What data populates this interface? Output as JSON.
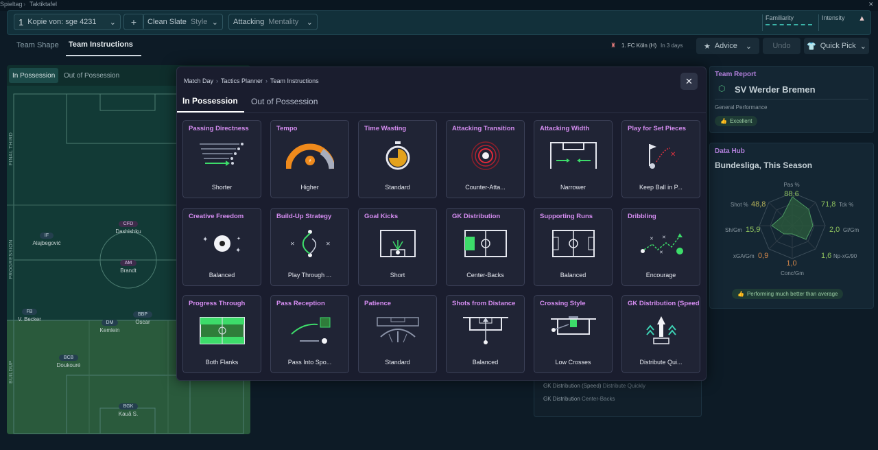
{
  "top": {
    "crumb1": "Spieltag",
    "crumb2": "Taktiktafel"
  },
  "header": {
    "tactic_number": "1",
    "tactic_name": "Kopie von: sge 4231",
    "add": "+",
    "style_value": "Clean Slate",
    "style_label": "Style",
    "mentality_value": "Attacking",
    "mentality_label": "Mentality",
    "familiarity": "Familiarity",
    "intensity": "Intensity"
  },
  "subtabs": {
    "team_shape": "Team Shape",
    "team_instructions": "Team Instructions"
  },
  "match": {
    "opponent": "1. FC Köln (H)",
    "when": "In 3 days"
  },
  "actions": {
    "advice": "Advice",
    "undo": "Undo",
    "quick_pick": "Quick Pick"
  },
  "pitch": {
    "tabs": [
      "In Possession",
      "Out of Possession"
    ],
    "zones": {
      "final": "FINAL THIRD",
      "progression": "PROGRESSION",
      "buildup": "BUILDUP"
    },
    "players": [
      {
        "role": "IF",
        "name": "Alajbegović"
      },
      {
        "role": "CFD",
        "name": "Dashishku"
      },
      {
        "role": "AM",
        "name": "Brandt"
      },
      {
        "role": "FB",
        "name": "V. Becker"
      },
      {
        "role": "DM",
        "name": "Kemlein"
      },
      {
        "role": "BBP",
        "name": "Öscar"
      },
      {
        "role": "BCB",
        "name": "Doukouré"
      },
      {
        "role": "BGK",
        "name": "Kauã S."
      }
    ]
  },
  "team_report": {
    "title": "Team Report",
    "team": "SV Werder Bremen",
    "label": "General Performance",
    "badge": "Excellent"
  },
  "data_hub": {
    "title": "Data Hub",
    "subtitle": "Bundesliga, This Season",
    "stats": [
      {
        "label": "Pas %",
        "value": "88,6"
      },
      {
        "label": "Tck %",
        "value": "71,8"
      },
      {
        "label": "Gl/Gm",
        "value": "2,0"
      },
      {
        "label": "Np-xG/90",
        "value": "1,6"
      },
      {
        "label": "Conc/Gm",
        "value": "1,0"
      },
      {
        "label": "xGA/Gm",
        "value": "0,9"
      },
      {
        "label": "Sh/Gm",
        "value": "15,9"
      },
      {
        "label": "Shot %",
        "value": "48,8"
      }
    ],
    "footer": "Performing much better than average"
  },
  "summary": [
    {
      "k": "GK Distribution (Speed)",
      "v": "Distribute Quickly"
    },
    {
      "k": "GK Distribution",
      "v": "Center-Backs"
    }
  ],
  "modal": {
    "breadcrumb": [
      "Match Day",
      "Tactics Planner",
      "Team Instructions"
    ],
    "tabs": [
      "In Possession",
      "Out of Possession"
    ],
    "close": "✕",
    "cards": [
      {
        "title": "Passing Directness",
        "value": "Shorter",
        "icon": "passing-directness-icon"
      },
      {
        "title": "Tempo",
        "value": "Higher",
        "icon": "tempo-gauge-icon"
      },
      {
        "title": "Time Wasting",
        "value": "Standard",
        "icon": "stopwatch-icon"
      },
      {
        "title": "Attacking Transition",
        "value": "Counter-Atta...",
        "icon": "transition-target-icon"
      },
      {
        "title": "Attacking Width",
        "value": "Narrower",
        "icon": "attacking-width-icon"
      },
      {
        "title": "Play for Set Pieces",
        "value": "Keep Ball in P...",
        "icon": "set-pieces-flag-icon"
      },
      {
        "title": "Creative Freedom",
        "value": "Balanced",
        "icon": "creative-ball-icon"
      },
      {
        "title": "Build-Up Strategy",
        "value": "Play Through ...",
        "icon": "build-up-icon"
      },
      {
        "title": "Goal Kicks",
        "value": "Short",
        "icon": "goal-kicks-icon"
      },
      {
        "title": "GK Distribution",
        "value": "Center-Backs",
        "icon": "gk-distribution-icon"
      },
      {
        "title": "Supporting Runs",
        "value": "Balanced",
        "icon": "supporting-runs-icon"
      },
      {
        "title": "Dribbling",
        "value": "Encourage",
        "icon": "dribbling-icon"
      },
      {
        "title": "Progress Through",
        "value": "Both Flanks",
        "icon": "progress-through-icon"
      },
      {
        "title": "Pass Reception",
        "value": "Pass Into Spo...",
        "icon": "pass-reception-icon"
      },
      {
        "title": "Patience",
        "value": "Standard",
        "icon": "patience-icon"
      },
      {
        "title": "Shots from Distance",
        "value": "Balanced",
        "icon": "shots-distance-icon"
      },
      {
        "title": "Crossing Style",
        "value": "Low Crosses",
        "icon": "crossing-style-icon"
      },
      {
        "title": "GK Distribution (Speed",
        "value": "Distribute Qui...",
        "icon": "gk-speed-icon"
      }
    ]
  }
}
